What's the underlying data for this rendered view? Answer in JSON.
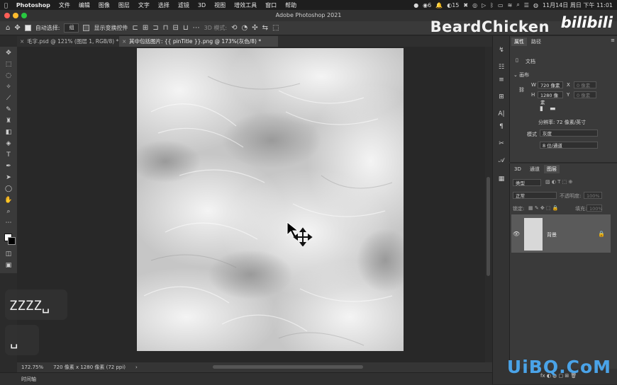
{
  "menubar": {
    "app": "Photoshop",
    "items": [
      "文件",
      "编辑",
      "图像",
      "图层",
      "文字",
      "选择",
      "滤镜",
      "3D",
      "视图",
      "增效工具",
      "窗口",
      "帮助"
    ],
    "status_num1": "6",
    "status_num2": "15",
    "datetime": "11月14日 周日 下午 11:01"
  },
  "window": {
    "title": "Adobe Photoshop 2021"
  },
  "options": {
    "auto_select_label": "自动选择:",
    "auto_select_value": "组",
    "show_transform_label": "显示变换控件",
    "mode_3d_label": "3D 模式:"
  },
  "watermark": {
    "text": "BeardChicken",
    "logo": "bilibili"
  },
  "tabs": [
    {
      "label": "毛字.psd @ 121% (图层 1, RGB/8) *",
      "active": false
    },
    {
      "label": "其中包括图片: {{ pinTitle }}.png @ 173%(灰色/8) *",
      "active": true
    }
  ],
  "status": {
    "zoom": "172.75%",
    "doc_info": "720 像素 x 1280 像素 (72 ppi)"
  },
  "timeline": {
    "label": "时间轴"
  },
  "key_overlays": {
    "top": "ZZZZ␣",
    "bottom": "␣"
  },
  "properties": {
    "tabs": [
      "属性",
      "路径"
    ],
    "doc_label": "文档",
    "section": "画布",
    "w_label": "W",
    "w_value": "720 像素",
    "x_label": "X",
    "x_placeholder": "0 像素",
    "h_label": "H",
    "h_value": "1280 像素",
    "y_label": "Y",
    "y_placeholder": "0 像素",
    "resolution": "分辨率: 72 像素/英寸",
    "mode_label": "模式",
    "mode_value": "灰度",
    "depth_value": "8 位/通道"
  },
  "layers": {
    "tabs": [
      "3D",
      "通道",
      "图层"
    ],
    "filter_kind": "类型",
    "blend_mode": "正常",
    "opacity_label": "不透明度:",
    "opacity_value": "100%",
    "lock_label": "锁定:",
    "fill_label": "填充:",
    "fill_value": "100%",
    "layer_name": "背景"
  },
  "site_watermark": "UiBQ.CoM",
  "colors": {
    "accent": "#4aa3e8",
    "close": "#ff5f57",
    "minimize": "#febc2e",
    "zoom": "#28c840"
  }
}
